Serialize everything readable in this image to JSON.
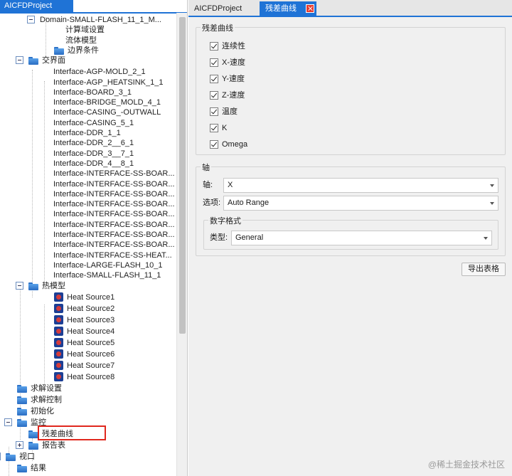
{
  "left_panel": {
    "tab_title": "AICFDProject",
    "tree": [
      {
        "label": "Domain-SMALL-FLASH_11_1_M...",
        "icon": "none",
        "toggle": "minus",
        "level": 3
      },
      {
        "label": "计算域设置",
        "icon": "none",
        "level": 4
      },
      {
        "label": "流体模型",
        "icon": "none",
        "level": 4
      },
      {
        "label": "边界条件",
        "icon": "folder-icon",
        "level": 4
      },
      {
        "label": "交界面",
        "icon": "folder-icon",
        "toggle": "minus",
        "level": 2
      },
      {
        "label": "Interface-AGP-MOLD_2_1",
        "level": 3
      },
      {
        "label": "Interface-AGP_HEATSINK_1_1",
        "level": 3
      },
      {
        "label": "Interface-BOARD_3_1",
        "level": 3
      },
      {
        "label": "Interface-BRIDGE_MOLD_4_1",
        "level": 3
      },
      {
        "label": "Interface-CASING_-OUTWALL",
        "level": 3
      },
      {
        "label": "Interface-CASING_5_1",
        "level": 3
      },
      {
        "label": "Interface-DDR_1_1",
        "level": 3
      },
      {
        "label": "Interface-DDR_2__6_1",
        "level": 3
      },
      {
        "label": "Interface-DDR_3__7_1",
        "level": 3
      },
      {
        "label": "Interface-DDR_4__8_1",
        "level": 3
      },
      {
        "label": "Interface-INTERFACE-SS-BOAR...",
        "level": 3
      },
      {
        "label": "Interface-INTERFACE-SS-BOAR...",
        "level": 3
      },
      {
        "label": "Interface-INTERFACE-SS-BOAR...",
        "level": 3
      },
      {
        "label": "Interface-INTERFACE-SS-BOAR...",
        "level": 3
      },
      {
        "label": "Interface-INTERFACE-SS-BOAR...",
        "level": 3
      },
      {
        "label": "Interface-INTERFACE-SS-BOAR...",
        "level": 3
      },
      {
        "label": "Interface-INTERFACE-SS-BOAR...",
        "level": 3
      },
      {
        "label": "Interface-INTERFACE-SS-BOAR...",
        "level": 3
      },
      {
        "label": "Interface-INTERFACE-SS-HEAT...",
        "level": 3
      },
      {
        "label": "Interface-LARGE-FLASH_10_1",
        "level": 3
      },
      {
        "label": "Interface-SMALL-FLASH_11_1",
        "level": 3
      },
      {
        "label": "热模型",
        "icon": "folder-icon",
        "toggle": "minus",
        "level": 2
      },
      {
        "label": "Heat Source1",
        "icon": "heat-source-icon",
        "level": 3
      },
      {
        "label": "Heat Source2",
        "icon": "heat-source-icon",
        "level": 3
      },
      {
        "label": "Heat Source3",
        "icon": "heat-source-icon",
        "level": 3
      },
      {
        "label": "Heat Source4",
        "icon": "heat-source-icon",
        "level": 3
      },
      {
        "label": "Heat Source5",
        "icon": "heat-source-icon",
        "level": 3
      },
      {
        "label": "Heat Source6",
        "icon": "heat-source-icon",
        "level": 3
      },
      {
        "label": "Heat Source7",
        "icon": "heat-source-icon",
        "level": 3
      },
      {
        "label": "Heat Source8",
        "icon": "heat-source-icon",
        "level": 3
      },
      {
        "label": "求解设置",
        "icon": "folder-icon",
        "level": 1
      },
      {
        "label": "求解控制",
        "icon": "folder-icon",
        "level": 1
      },
      {
        "label": "初始化",
        "icon": "folder-icon",
        "level": 1
      },
      {
        "label": "监控",
        "icon": "folder-icon",
        "toggle": "minus",
        "level": 1
      },
      {
        "label": "残差曲线",
        "icon": "folder-icon",
        "level": 2,
        "highlighted": true
      },
      {
        "label": "报告表",
        "icon": "folder-icon",
        "toggle": "plus",
        "level": 2
      },
      {
        "label": "视口",
        "icon": "folder-icon",
        "toggle": "minus",
        "level": 0
      },
      {
        "label": "结果",
        "icon": "folder-icon",
        "level": 1
      }
    ]
  },
  "right_panel": {
    "tabs": [
      {
        "label": "AICFDProject",
        "active": false
      },
      {
        "label": "残差曲线",
        "active": true
      }
    ],
    "residual_group": {
      "title": "残差曲线",
      "checkboxes": [
        {
          "label": "连续性",
          "checked": true
        },
        {
          "label": "X-速度",
          "checked": true
        },
        {
          "label": "Y-速度",
          "checked": true
        },
        {
          "label": "Z-速度",
          "checked": true
        },
        {
          "label": "温度",
          "checked": true
        },
        {
          "label": "K",
          "checked": true
        },
        {
          "label": "Omega",
          "checked": true
        }
      ]
    },
    "axis_group": {
      "title": "轴",
      "axis_label": "轴:",
      "axis_value": "X",
      "option_label": "选项:",
      "option_value": "Auto Range",
      "number_format": {
        "title": "数字格式",
        "type_label": "类型:",
        "type_value": "General"
      }
    },
    "export_button": "导出表格"
  },
  "watermark": "@稀土掘金技术社区",
  "colors": {
    "accent": "#1f73d6",
    "highlight_border": "#e0281e",
    "close_button": "#e63a2e"
  }
}
